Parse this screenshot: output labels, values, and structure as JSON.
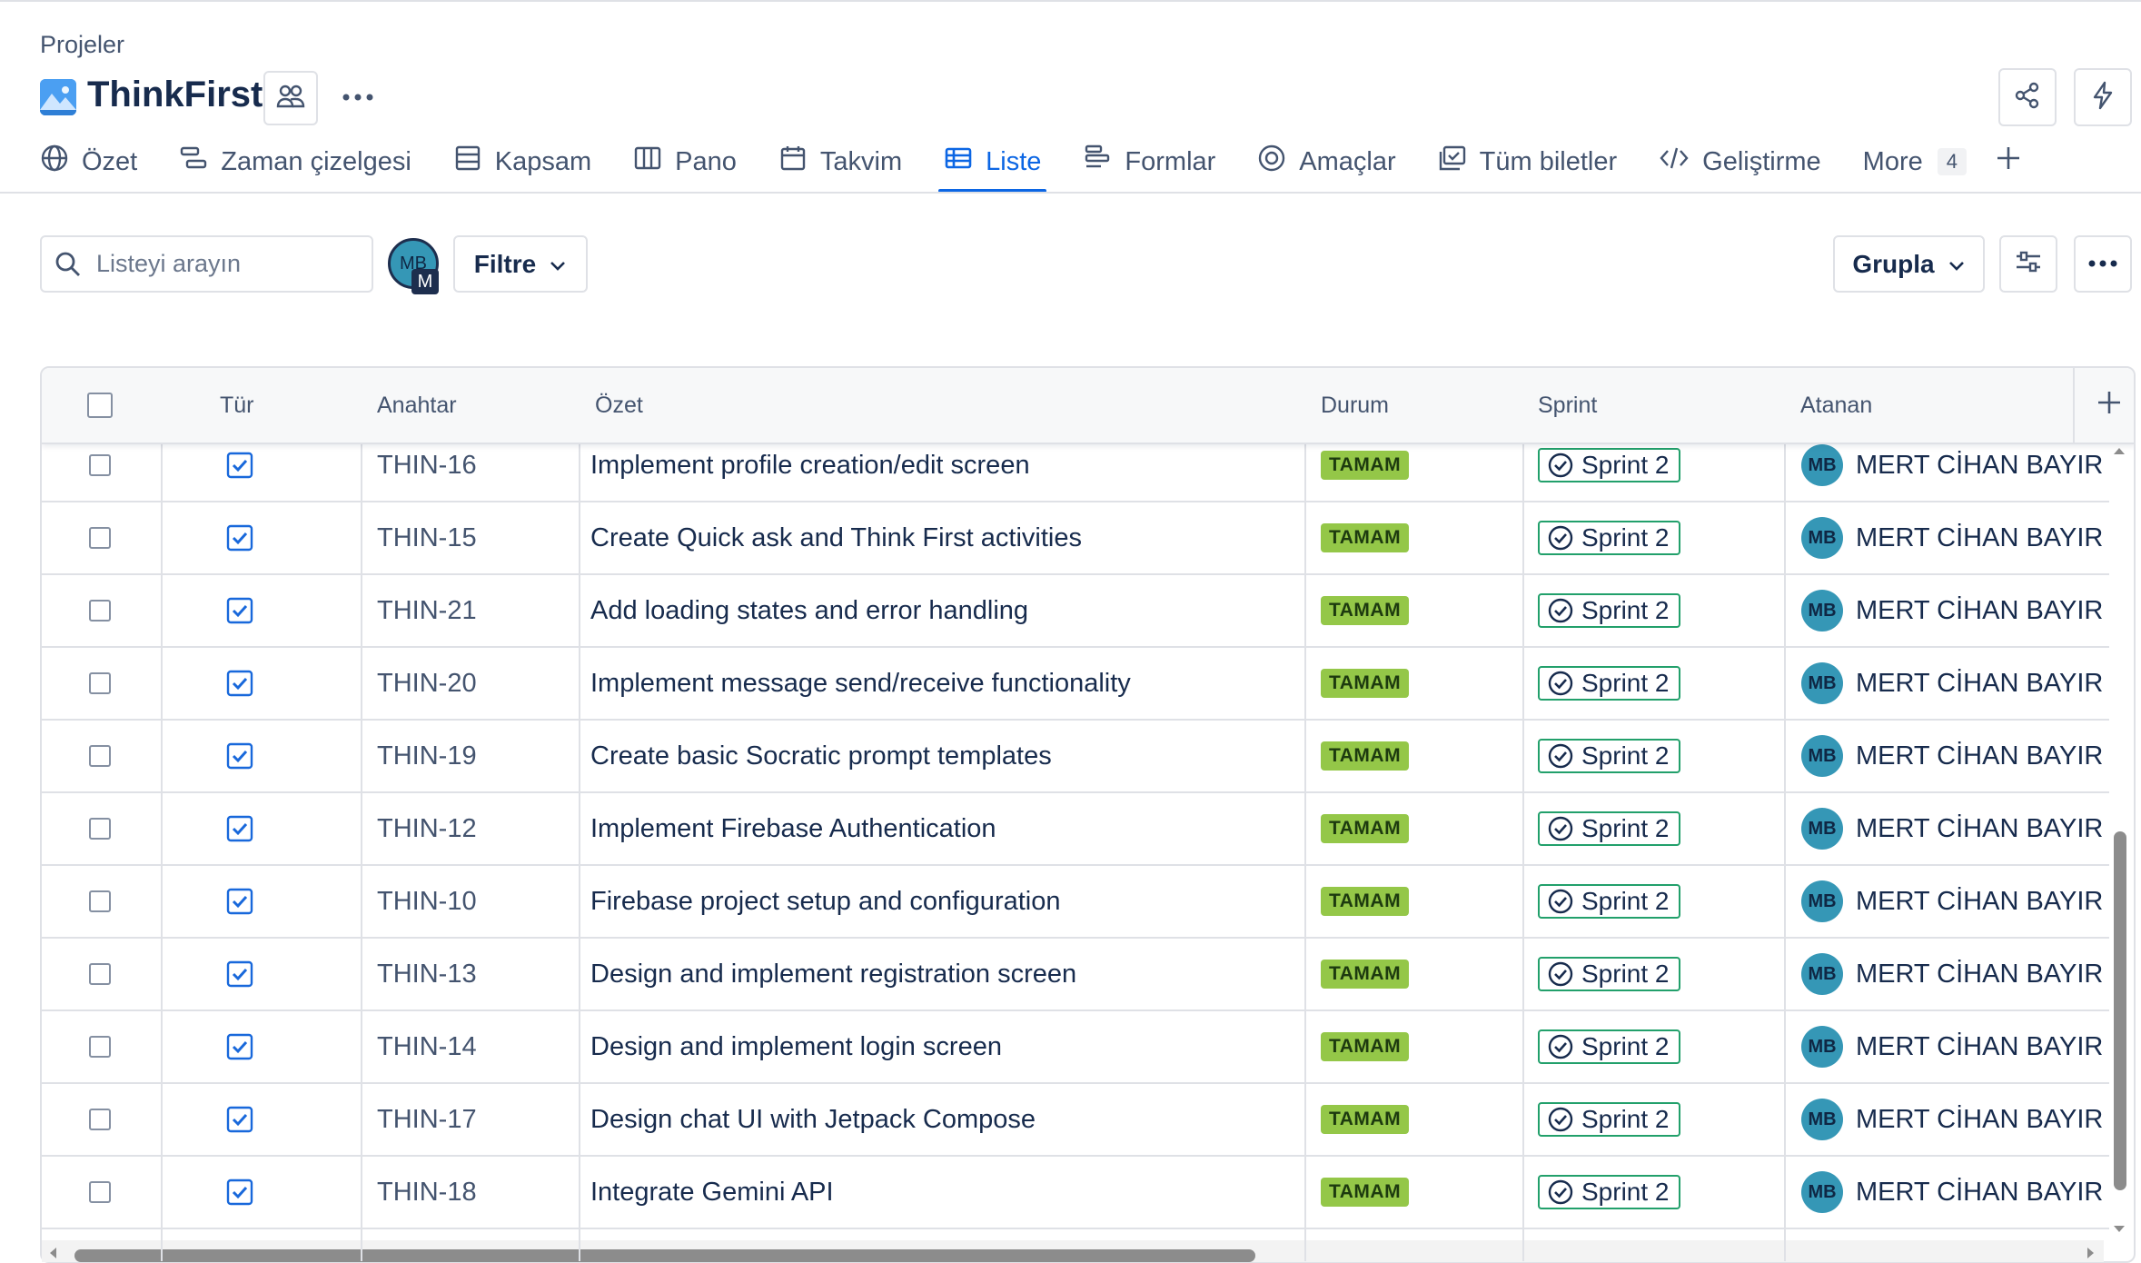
{
  "header": {
    "breadcrumb": "Projeler",
    "project_title": "ThinkFirst"
  },
  "tabs": [
    {
      "label": "Özet",
      "icon": "globe-icon"
    },
    {
      "label": "Zaman çizelgesi",
      "icon": "timeline-icon"
    },
    {
      "label": "Kapsam",
      "icon": "backlog-icon"
    },
    {
      "label": "Pano",
      "icon": "board-icon"
    },
    {
      "label": "Takvim",
      "icon": "calendar-icon"
    },
    {
      "label": "Liste",
      "icon": "list-icon",
      "active": true
    },
    {
      "label": "Formlar",
      "icon": "form-icon"
    },
    {
      "label": "Amaçlar",
      "icon": "goal-icon"
    },
    {
      "label": "Tüm biletler",
      "icon": "tickets-icon"
    },
    {
      "label": "Geliştirme",
      "icon": "code-icon"
    }
  ],
  "more_tab": {
    "label": "More",
    "count": "4"
  },
  "toolbar": {
    "search_placeholder": "Listeyi arayın",
    "avatar_initials": "MB",
    "avatar_badge": "M",
    "filter_label": "Filtre",
    "group_label": "Grupla"
  },
  "table": {
    "columns": [
      "Tür",
      "Anahtar",
      "Özet",
      "Durum",
      "Sprint",
      "Atanan"
    ],
    "rows": [
      {
        "key": "THIN-16",
        "summary": "Implement profile creation/edit screen",
        "status": "TAMAM",
        "sprint": "Sprint 2",
        "assignee_initials": "MB",
        "assignee": "MERT CİHAN BAYIR"
      },
      {
        "key": "THIN-15",
        "summary": "Create Quick ask and Think First activities",
        "status": "TAMAM",
        "sprint": "Sprint 2",
        "assignee_initials": "MB",
        "assignee": "MERT CİHAN BAYIR"
      },
      {
        "key": "THIN-21",
        "summary": "Add loading states and error handling",
        "status": "TAMAM",
        "sprint": "Sprint 2",
        "assignee_initials": "MB",
        "assignee": "MERT CİHAN BAYIR"
      },
      {
        "key": "THIN-20",
        "summary": "Implement message send/receive functionality",
        "status": "TAMAM",
        "sprint": "Sprint 2",
        "assignee_initials": "MB",
        "assignee": "MERT CİHAN BAYIR"
      },
      {
        "key": "THIN-19",
        "summary": "Create basic Socratic prompt templates",
        "status": "TAMAM",
        "sprint": "Sprint 2",
        "assignee_initials": "MB",
        "assignee": "MERT CİHAN BAYIR"
      },
      {
        "key": "THIN-12",
        "summary": "Implement Firebase Authentication",
        "status": "TAMAM",
        "sprint": "Sprint 2",
        "assignee_initials": "MB",
        "assignee": "MERT CİHAN BAYIR"
      },
      {
        "key": "THIN-10",
        "summary": "Firebase project setup and configuration",
        "status": "TAMAM",
        "sprint": "Sprint 2",
        "assignee_initials": "MB",
        "assignee": "MERT CİHAN BAYIR"
      },
      {
        "key": "THIN-13",
        "summary": "Design and implement registration screen",
        "status": "TAMAM",
        "sprint": "Sprint 2",
        "assignee_initials": "MB",
        "assignee": "MERT CİHAN BAYIR"
      },
      {
        "key": "THIN-14",
        "summary": "Design and implement login screen",
        "status": "TAMAM",
        "sprint": "Sprint 2",
        "assignee_initials": "MB",
        "assignee": "MERT CİHAN BAYIR"
      },
      {
        "key": "THIN-17",
        "summary": "Design chat UI with Jetpack Compose",
        "status": "TAMAM",
        "sprint": "Sprint 2",
        "assignee_initials": "MB",
        "assignee": "MERT CİHAN BAYIR"
      },
      {
        "key": "THIN-18",
        "summary": "Integrate Gemini API",
        "status": "TAMAM",
        "sprint": "Sprint 2",
        "assignee_initials": "MB",
        "assignee": "MERT CİHAN BAYIR"
      }
    ]
  },
  "colors": {
    "accent": "#0c66e4",
    "status_done": "#94c748",
    "sprint_border": "#22a06b",
    "avatar": "#3597b6"
  }
}
